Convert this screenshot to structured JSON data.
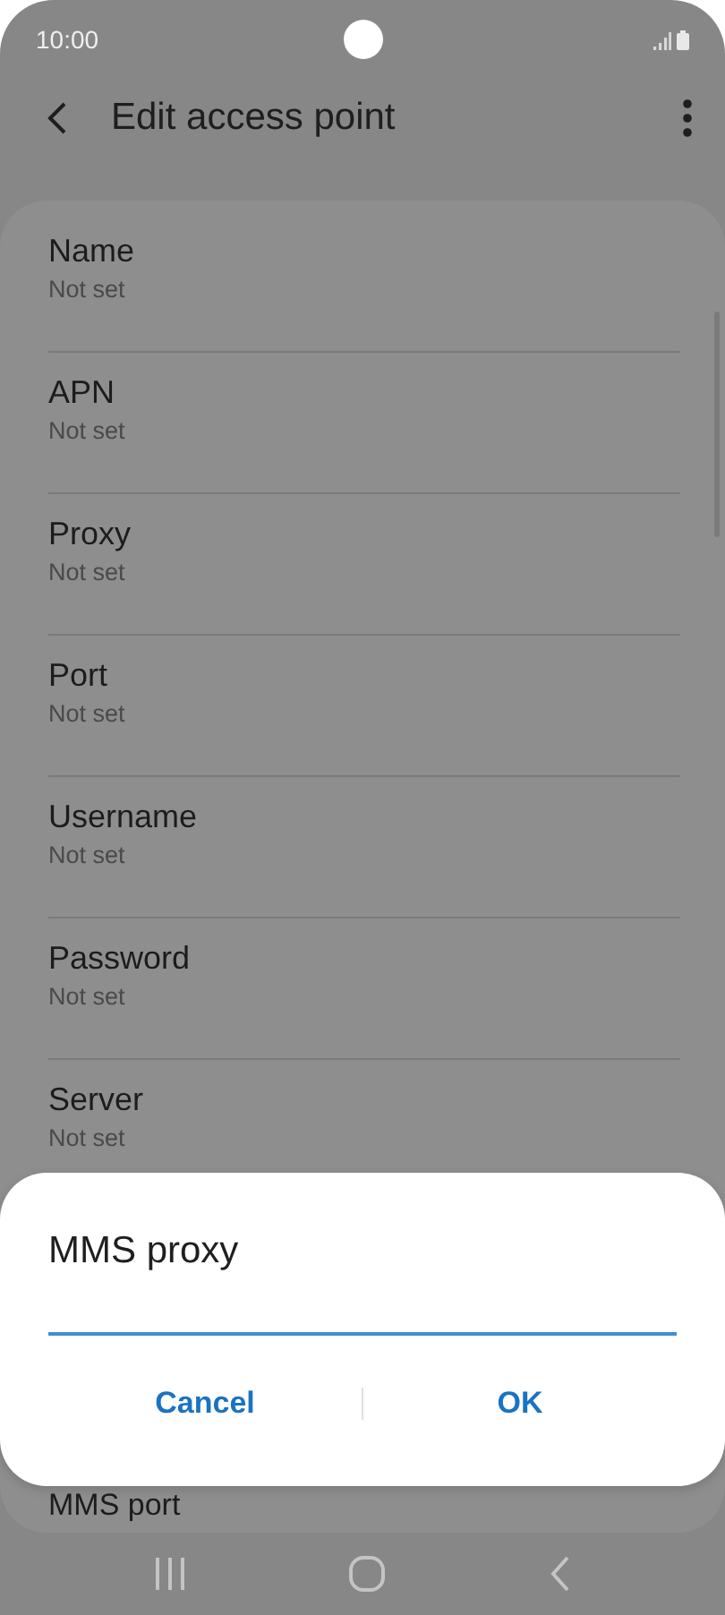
{
  "status_bar": {
    "time": "10:00"
  },
  "header": {
    "title": "Edit access point"
  },
  "settings": [
    {
      "title": "Name",
      "value": "Not set"
    },
    {
      "title": "APN",
      "value": "Not set"
    },
    {
      "title": "Proxy",
      "value": "Not set"
    },
    {
      "title": "Port",
      "value": "Not set"
    },
    {
      "title": "Username",
      "value": "Not set"
    },
    {
      "title": "Password",
      "value": "Not set"
    },
    {
      "title": "Server",
      "value": "Not set"
    }
  ],
  "partial_row": {
    "title": "MMS port"
  },
  "dialog": {
    "title": "MMS proxy",
    "buttons": [
      "Cancel",
      "OK"
    ]
  }
}
